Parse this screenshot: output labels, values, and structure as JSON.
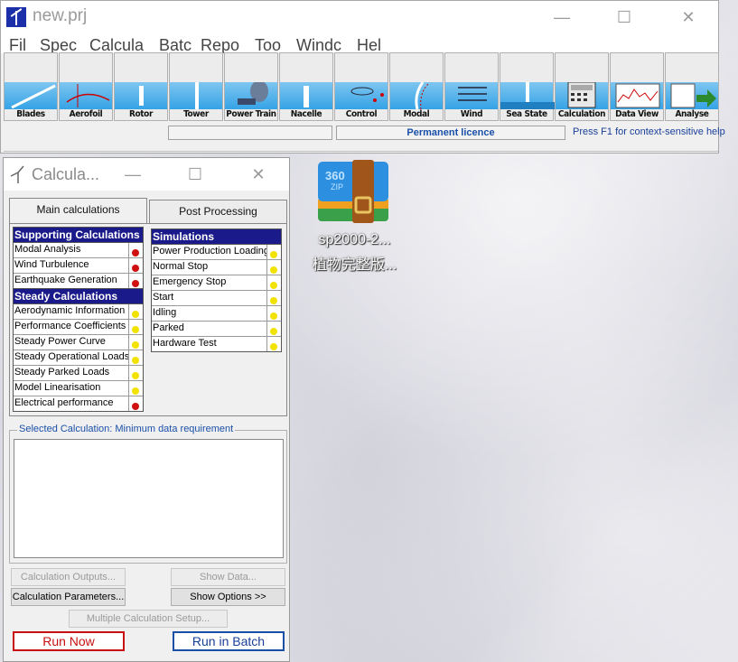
{
  "main_window": {
    "title": "new.prj",
    "controls": {
      "minimize": "—",
      "maximize": "☐",
      "close": "✕"
    },
    "menu": [
      "Fil",
      "Spec",
      "Calcula",
      "Batc",
      "Repo",
      "Too",
      "Windc",
      "Hel"
    ],
    "toolbar": [
      "Blades",
      "Aerofoil",
      "Rotor",
      "Tower",
      "Power Train",
      "Nacelle",
      "Control",
      "Modal",
      "Wind",
      "Sea State",
      "Calculation",
      "Data View",
      "Analyse"
    ],
    "status": {
      "licence": "Permanent licence",
      "help": "Press F1 for context-sensitive help"
    }
  },
  "desktop_icon": {
    "label_line1": "sp2000-2...",
    "label_line2": "植物完整版...",
    "badge": "360",
    "badge_sub": "ZIP"
  },
  "calc_window": {
    "title": "Calcula...",
    "controls": {
      "minimize": "—",
      "maximize": "☐",
      "close": "✕"
    },
    "tabs": {
      "main": "Main calculations",
      "post": "Post Processing"
    },
    "supporting": {
      "header": "Supporting Calculations",
      "items": [
        {
          "label": "Modal Analysis",
          "status": "red"
        },
        {
          "label": "Wind Turbulence",
          "status": "red"
        },
        {
          "label": "Earthquake Generation",
          "status": "red"
        }
      ]
    },
    "steady": {
      "header": "Steady Calculations",
      "items": [
        {
          "label": "Aerodynamic Information",
          "status": "yellow"
        },
        {
          "label": "Performance Coefficients",
          "status": "yellow"
        },
        {
          "label": "Steady Power Curve",
          "status": "yellow"
        },
        {
          "label": "Steady Operational Loads",
          "status": "yellow"
        },
        {
          "label": "Steady Parked Loads",
          "status": "yellow"
        },
        {
          "label": "Model Linearisation",
          "status": "yellow"
        },
        {
          "label": "Electrical performance",
          "status": "red"
        }
      ]
    },
    "simulations": {
      "header": "Simulations",
      "items": [
        {
          "label": "Power Production Loading",
          "status": "yellow"
        },
        {
          "label": "Normal Stop",
          "status": "yellow"
        },
        {
          "label": "Emergency Stop",
          "status": "yellow"
        },
        {
          "label": "Start",
          "status": "yellow"
        },
        {
          "label": "Idling",
          "status": "yellow"
        },
        {
          "label": "Parked",
          "status": "yellow"
        },
        {
          "label": "Hardware Test",
          "status": "yellow"
        }
      ]
    },
    "selected_calc_label": "Selected Calculation: Minimum data requirement",
    "buttons": {
      "calc_outputs": "Calculation Outputs...",
      "show_data": "Show Data...",
      "calc_params": "Calculation Parameters...",
      "show_options": "Show Options >>",
      "multi_setup": "Multiple Calculation Setup...",
      "run_now": "Run Now",
      "run_batch": "Run in Batch"
    }
  },
  "colors": {
    "group_header": "#1a1a8a",
    "status_red": "#d01010",
    "status_yellow": "#f2e200",
    "run_now": "#c81010",
    "run_batch": "#1a4fa8"
  }
}
